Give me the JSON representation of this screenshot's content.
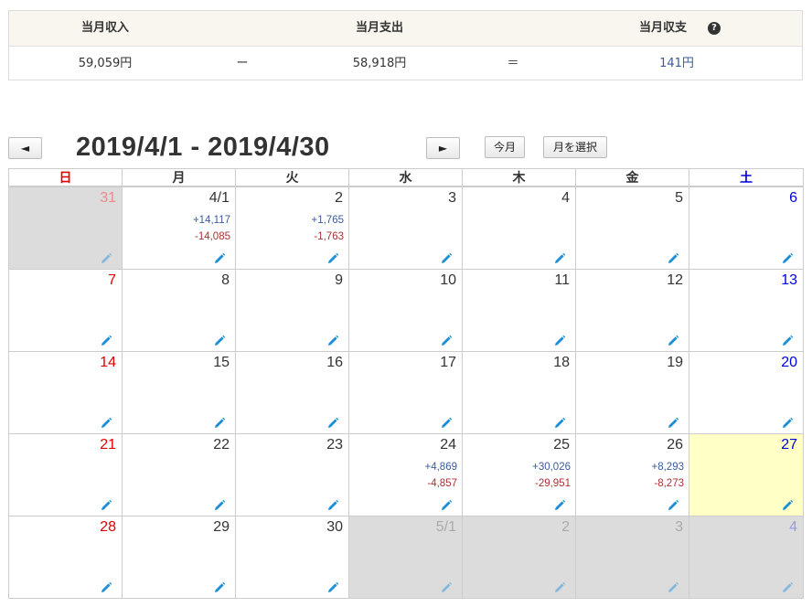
{
  "summary": {
    "headers": {
      "income": "当月収入",
      "expense": "当月支出",
      "balance": "当月収支"
    },
    "income": "59,059円",
    "minus": "ー",
    "expense": "58,918円",
    "equals": "＝",
    "balance": "141円",
    "help_icon": "question-icon"
  },
  "nav": {
    "prev_label": "◄",
    "next_label": "►",
    "range": "2019/4/1 - 2019/4/30",
    "today_label": "今月",
    "select_month_label": "月を選択"
  },
  "calendar": {
    "weekdays": [
      "日",
      "月",
      "火",
      "水",
      "木",
      "金",
      "土"
    ],
    "weekday_colors": [
      "#e00000",
      "#333333",
      "#333333",
      "#333333",
      "#333333",
      "#333333",
      "#0000dd"
    ],
    "weeks": [
      [
        {
          "label": "31",
          "other": true
        },
        {
          "label": "4/1",
          "inc": "+14,117",
          "exp": "-14,085"
        },
        {
          "label": "2",
          "inc": "+1,765",
          "exp": "-1,763"
        },
        {
          "label": "3"
        },
        {
          "label": "4"
        },
        {
          "label": "5"
        },
        {
          "label": "6"
        }
      ],
      [
        {
          "label": "7"
        },
        {
          "label": "8"
        },
        {
          "label": "9"
        },
        {
          "label": "10"
        },
        {
          "label": "11"
        },
        {
          "label": "12"
        },
        {
          "label": "13"
        }
      ],
      [
        {
          "label": "14"
        },
        {
          "label": "15"
        },
        {
          "label": "16"
        },
        {
          "label": "17"
        },
        {
          "label": "18"
        },
        {
          "label": "19"
        },
        {
          "label": "20"
        }
      ],
      [
        {
          "label": "21"
        },
        {
          "label": "22"
        },
        {
          "label": "23"
        },
        {
          "label": "24",
          "inc": "+4,869",
          "exp": "-4,857"
        },
        {
          "label": "25",
          "inc": "+30,026",
          "exp": "-29,951"
        },
        {
          "label": "26",
          "inc": "+8,293",
          "exp": "-8,273"
        },
        {
          "label": "27",
          "today": true
        }
      ],
      [
        {
          "label": "28"
        },
        {
          "label": "29"
        },
        {
          "label": "30"
        },
        {
          "label": "5/1",
          "other": true
        },
        {
          "label": "2",
          "other": true
        },
        {
          "label": "3",
          "other": true
        },
        {
          "label": "4",
          "other": true
        }
      ]
    ],
    "edit_icon": "pencil-icon",
    "pencil_color": "#1a8fd6"
  }
}
